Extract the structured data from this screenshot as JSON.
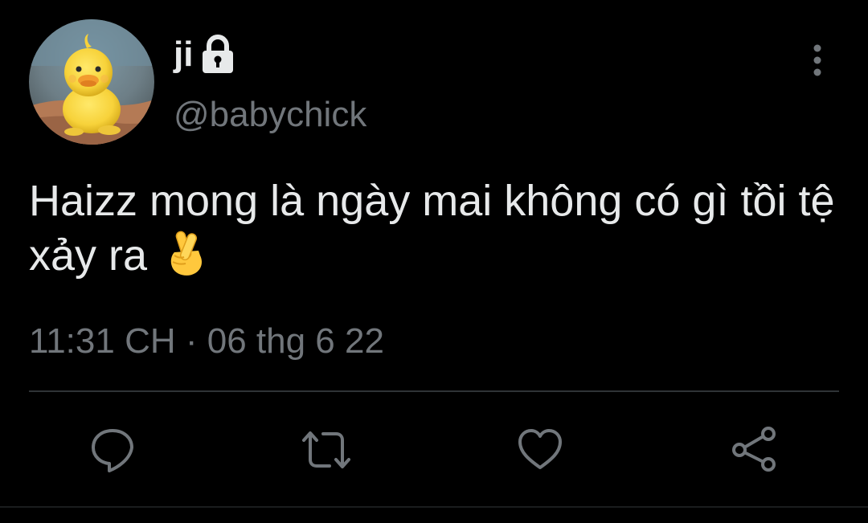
{
  "user": {
    "display_name": "ji",
    "handle": "@babychick",
    "avatar_icon": "duckling-avatar",
    "protected_icon": "lock-icon"
  },
  "tweet": {
    "text": "Haizz mong là ngày mai không có gì tồi tệ xảy ra",
    "emoji": "🤞",
    "time": "11:31 CH",
    "separator": "·",
    "date": "06 thg 6 22"
  },
  "actions": [
    {
      "name": "reply",
      "icon": "reply-icon"
    },
    {
      "name": "retweet",
      "icon": "retweet-icon"
    },
    {
      "name": "like",
      "icon": "heart-icon"
    },
    {
      "name": "share",
      "icon": "share-icon"
    }
  ],
  "colors": {
    "background": "#000000",
    "primary_text": "#e7e9ea",
    "secondary_text": "#71767b",
    "divider": "#2f3336"
  }
}
